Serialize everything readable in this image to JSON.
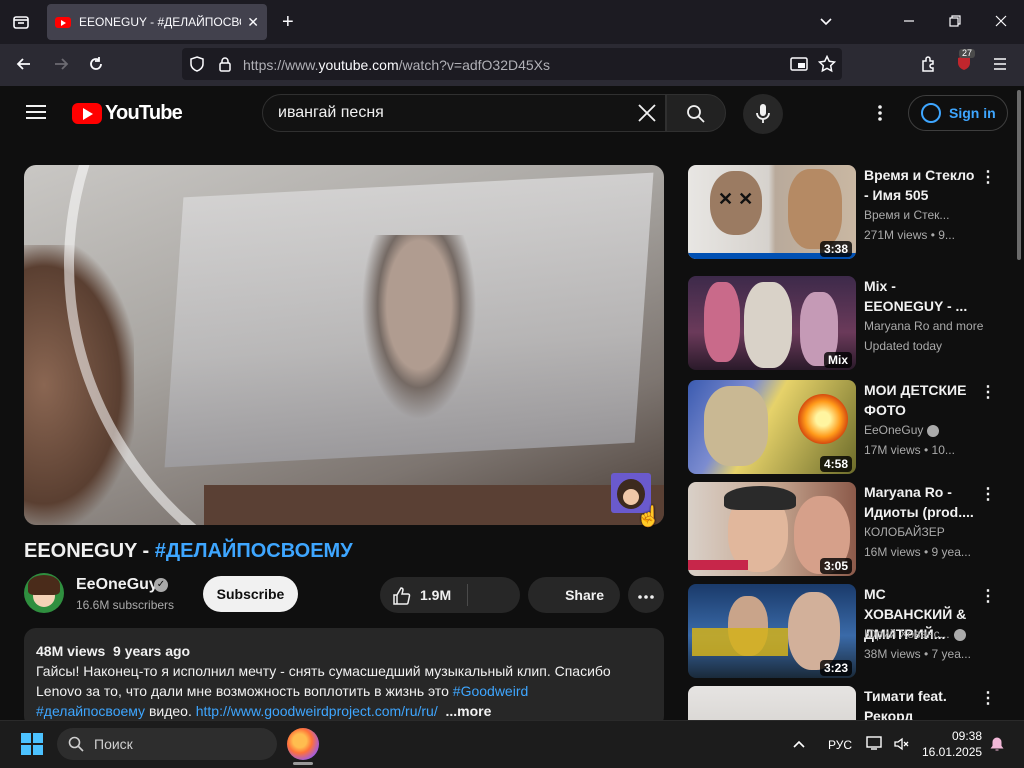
{
  "browser": {
    "tab_title": "EEONEGUY - #ДЕЛАЙПОСВОЕМУ",
    "url_prefix": "https://www.",
    "url_host": "youtube.com",
    "url_path": "/watch?v=adfO32D45Xs",
    "extension_badge": "27"
  },
  "youtube": {
    "logo_text": "YouTube",
    "search_query": "ивангай песня",
    "signin_label": "Sign in"
  },
  "video": {
    "title_main": "EEONEGUY - ",
    "title_hashtag": "#ДЕЛАЙПОСВОЕМУ",
    "channel_name": "EeOneGuy",
    "subscribers": "16.6M subscribers",
    "subscribe_label": "Subscribe",
    "likes": "1.9M",
    "share_label": "Share",
    "views": "48M views",
    "age": "9 years ago",
    "description_line1": "Гайсы! Наконец-то я исполнил мечту - снять сумасшедший музыкальный клип. Спасибо",
    "description_line2_text": "Lenovo за то, что дали мне возможность воплотить в жизнь это ",
    "description_line2_link": "#Goodweird",
    "description_line3_link": "#делайпосвоему",
    "description_line3_text": " видео. ",
    "description_line3_url": "http://www.goodweirdproject.com/ru/ru/",
    "more_label": "...more"
  },
  "recommendations": [
    {
      "title": "Время и Стекло - Имя 505",
      "channel": "Время и Стек...",
      "stats": "271M views • 9...",
      "duration": "3:38",
      "verified": false
    },
    {
      "title": "Mix - EEONEGUY - ...",
      "channel": "Maryana Ro and more",
      "stats": "Updated today",
      "duration": "Mix",
      "verified": false
    },
    {
      "title": "МОИ ДЕТСКИЕ ФОТО",
      "channel": "EeOneGuy",
      "stats": "17M views • 10...",
      "duration": "4:58",
      "verified": true
    },
    {
      "title": "Maryana Ro - Идиоты (prod....",
      "channel": "КОЛОБАЙЗЕР",
      "stats": "16M views • 9 yea...",
      "duration": "3:05",
      "verified": false
    },
    {
      "title": "MC ХОВАНСКИЙ & ДМИТРИЙ...",
      "channel": "Юрий Хованс...",
      "stats": "38M views • 7 yea...",
      "duration": "3:23",
      "verified": true
    },
    {
      "title": "Тимати feat. Рекорд Оркест...",
      "channel": "",
      "stats": "",
      "duration": "",
      "verified": false
    }
  ],
  "taskbar": {
    "search_placeholder": "Поиск",
    "language": "РУС",
    "time": "09:38",
    "date": "16.01.2025"
  },
  "colors": {
    "accent_blue": "#3ea6ff",
    "youtube_red": "#ff0000",
    "background": "#0f0f0f"
  }
}
